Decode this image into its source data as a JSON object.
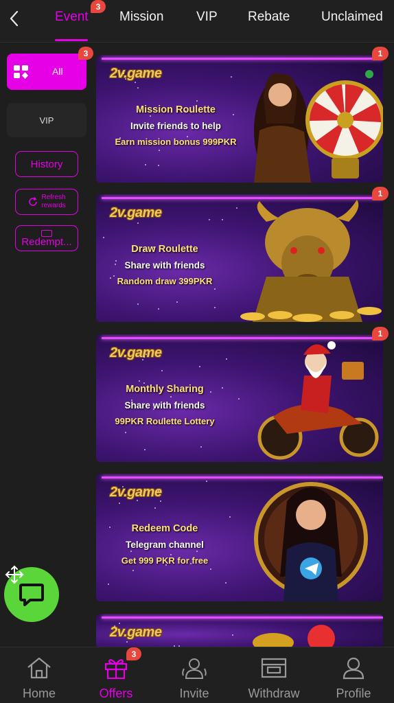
{
  "tabs": [
    {
      "label": "Event",
      "badge": "3",
      "active": true
    },
    {
      "label": "Mission"
    },
    {
      "label": "VIP"
    },
    {
      "label": "Rebate"
    },
    {
      "label": "Unclaimed"
    }
  ],
  "sidebar": {
    "all": {
      "label": "All",
      "badge": "3"
    },
    "vip": {
      "label": "VIP"
    },
    "history": {
      "label": "History"
    },
    "refresh": {
      "line1": "Refresh",
      "line2": "rewards"
    },
    "redeem": {
      "label": "Redempt..."
    }
  },
  "banners": [
    {
      "brand": "2v.game",
      "title": "Mission Roulette",
      "line2": "Invite friends to help",
      "line3": "Earn mission bonus 999PKR",
      "badge": "1"
    },
    {
      "brand": "2v.game",
      "title": "Draw Roulette",
      "line2": "Share with friends",
      "line3": "Random draw 399PKR",
      "badge": "1"
    },
    {
      "brand": "2v.game",
      "title": "Monthly Sharing",
      "line2": "Share with friends",
      "line3": "99PKR Roulette Lottery",
      "badge": "1"
    },
    {
      "brand": "2v.game",
      "title": "Redeem Code",
      "line2": "Telegram channel",
      "line3": "Get 999 PKR for free"
    },
    {
      "brand": "2v.game"
    }
  ],
  "bottom_nav": [
    {
      "label": "Home",
      "icon": "home-icon"
    },
    {
      "label": "Offers",
      "icon": "gift-icon",
      "badge": "3",
      "active": true
    },
    {
      "label": "Invite",
      "icon": "invite-icon"
    },
    {
      "label": "Withdraw",
      "icon": "withdraw-icon"
    },
    {
      "label": "Profile",
      "icon": "profile-icon"
    }
  ],
  "colors": {
    "accent": "#e600e6",
    "badge": "#e8473e",
    "chat": "#5bd63a",
    "background": "#1e1e1e"
  }
}
